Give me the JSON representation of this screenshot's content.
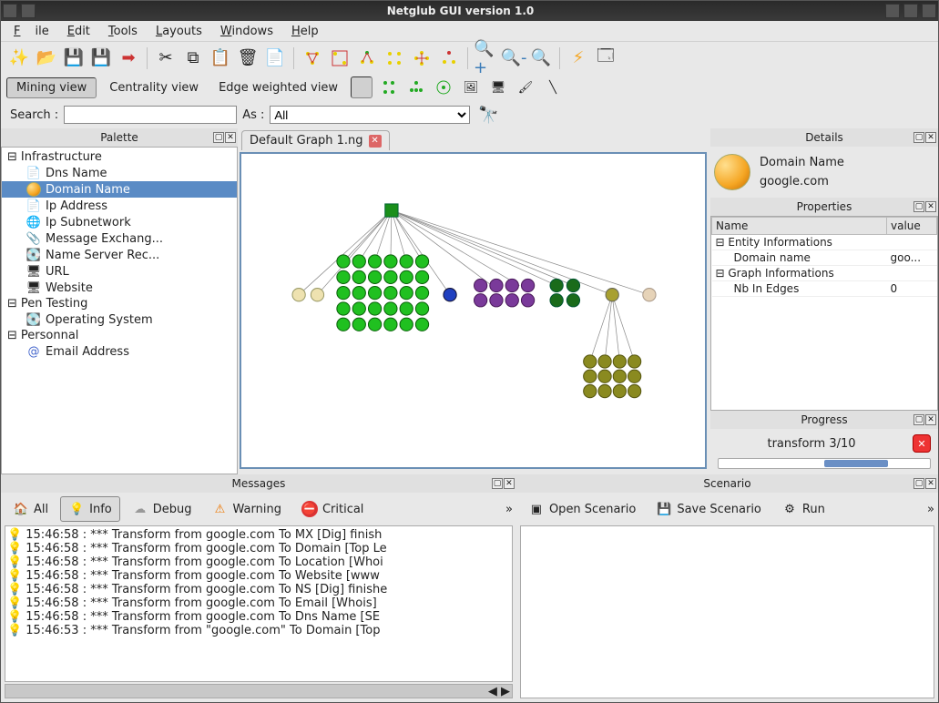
{
  "window": {
    "title": "Netglub GUI version 1.0"
  },
  "menu": {
    "file": "File",
    "edit": "Edit",
    "tools": "Tools",
    "layouts": "Layouts",
    "windows": "Windows",
    "help": "Help"
  },
  "views": {
    "mining": "Mining view",
    "centrality": "Centrality view",
    "edge": "Edge weighted view"
  },
  "search": {
    "label": "Search :",
    "as": "As :",
    "value": "",
    "options": [
      "All"
    ]
  },
  "palette": {
    "title": "Palette",
    "groups": [
      {
        "label": "Infrastructure",
        "items": [
          {
            "label": "Dns Name",
            "icon": "doc"
          },
          {
            "label": "Domain Name",
            "icon": "orb",
            "selected": true
          },
          {
            "label": "Ip Address",
            "icon": "doc"
          },
          {
            "label": "Ip Subnetwork",
            "icon": "net"
          },
          {
            "label": "Message Exchang...",
            "icon": "clip"
          },
          {
            "label": "Name Server Rec...",
            "icon": "srv"
          },
          {
            "label": "URL",
            "icon": "mon"
          },
          {
            "label": "Website",
            "icon": "mon"
          }
        ]
      },
      {
        "label": "Pen Testing",
        "items": [
          {
            "label": "Operating System",
            "icon": "srv"
          }
        ]
      },
      {
        "label": "Personnal",
        "items": [
          {
            "label": "Email Address",
            "icon": "at"
          }
        ]
      }
    ]
  },
  "tab": {
    "label": "Default Graph 1.ng"
  },
  "details": {
    "title": "Details",
    "entity_type": "Domain Name",
    "entity_value": "google.com"
  },
  "properties": {
    "title": "Properties",
    "headers": {
      "name": "Name",
      "value": "value"
    },
    "rows": [
      {
        "kind": "group",
        "name": "Entity Informations"
      },
      {
        "kind": "row",
        "name": "Domain name",
        "value": "goo..."
      },
      {
        "kind": "group",
        "name": "Graph Informations"
      },
      {
        "kind": "row",
        "name": "Nb In Edges",
        "value": "0"
      }
    ]
  },
  "progress": {
    "title": "Progress",
    "text": "transform 3/10"
  },
  "messages": {
    "title": "Messages",
    "filters": {
      "all": "All",
      "info": "Info",
      "debug": "Debug",
      "warning": "Warning",
      "critical": "Critical"
    },
    "items": [
      "15:46:58 : *** Transform from google.com To MX [Dig] finish",
      "15:46:58 : *** Transform from google.com To Domain [Top Le",
      "15:46:58 : *** Transform from google.com To Location [Whoi",
      "15:46:58 : *** Transform from google.com To Website [www",
      "15:46:58 : *** Transform from google.com To NS [Dig] finishe",
      "15:46:58 : *** Transform from google.com To Email [Whois] ",
      "15:46:58 : *** Transform from google.com To Dns Name [SE",
      "15:46:53 : *** Transform from \"google.com\" To Domain [Top"
    ]
  },
  "scenario": {
    "title": "Scenario",
    "open": "Open Scenario",
    "save": "Save Scenario",
    "run": "Run"
  }
}
